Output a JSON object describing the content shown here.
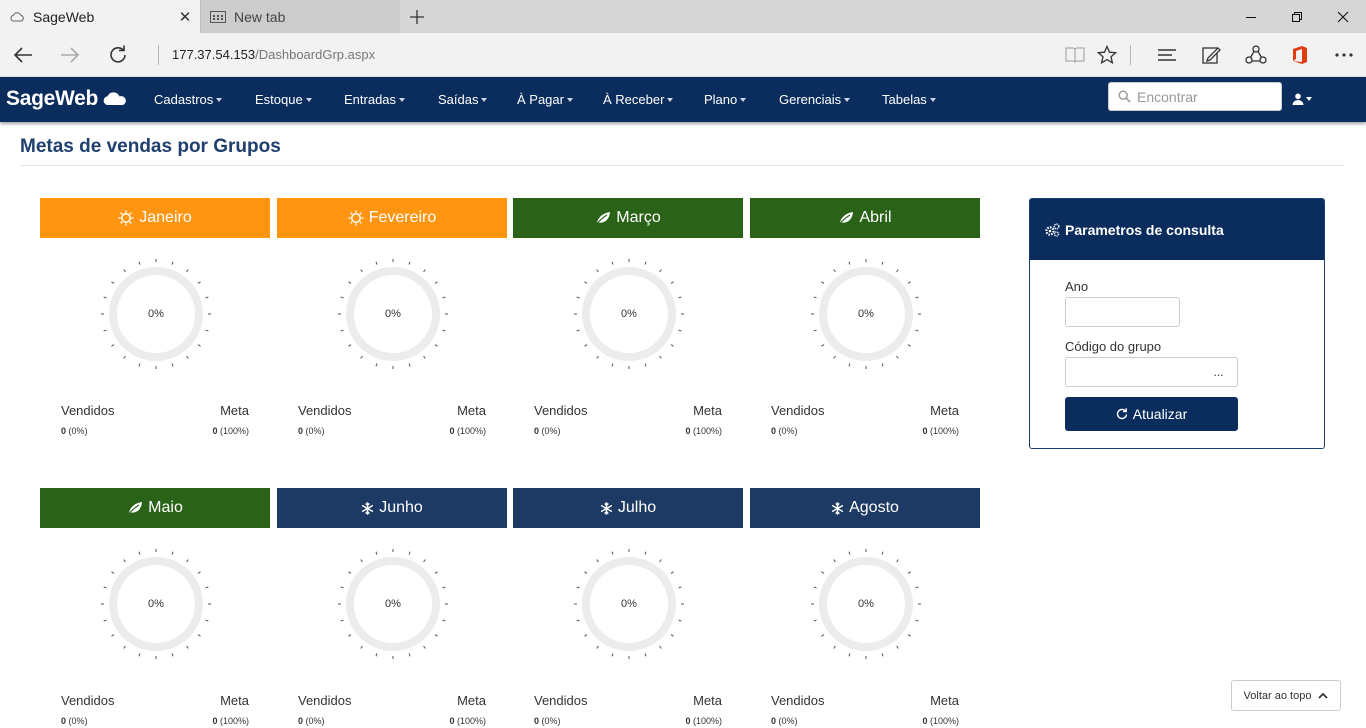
{
  "browser": {
    "tabs": [
      {
        "title": "SageWeb",
        "active": true
      },
      {
        "title": "New tab",
        "active": false
      }
    ],
    "address": {
      "host": "177.37.54.153",
      "path": "/DashboardGrp.aspx"
    }
  },
  "app": {
    "brand": "SageWeb",
    "menu": [
      "Cadastros",
      "Estoque",
      "Entradas",
      "Saídas",
      "À Pagar",
      "À Receber",
      "Plano",
      "Gerenciais",
      "Tabelas"
    ],
    "search_placeholder": "Encontrar"
  },
  "page": {
    "title": "Metas de vendas por Grupos"
  },
  "months": [
    {
      "name": "Janeiro",
      "icon": "sun-icon",
      "color": "#ff9511",
      "percent": "0%",
      "sold_label": "Vendidos",
      "goal_label": "Meta",
      "sold_value": "0",
      "sold_pct": "(0%)",
      "goal_value": "0",
      "goal_pct": "(100%)"
    },
    {
      "name": "Fevereiro",
      "icon": "sun-icon",
      "color": "#ff9511",
      "percent": "0%",
      "sold_label": "Vendidos",
      "goal_label": "Meta",
      "sold_value": "0",
      "sold_pct": "(0%)",
      "goal_value": "0",
      "goal_pct": "(100%)"
    },
    {
      "name": "Março",
      "icon": "leaf-icon",
      "color": "#2a6218",
      "percent": "0%",
      "sold_label": "Vendidos",
      "goal_label": "Meta",
      "sold_value": "0",
      "sold_pct": "(0%)",
      "goal_value": "0",
      "goal_pct": "(100%)"
    },
    {
      "name": "Abril",
      "icon": "leaf-icon",
      "color": "#2a6218",
      "percent": "0%",
      "sold_label": "Vendidos",
      "goal_label": "Meta",
      "sold_value": "0",
      "sold_pct": "(0%)",
      "goal_value": "0",
      "goal_pct": "(100%)"
    },
    {
      "name": "Maio",
      "icon": "leaf-icon",
      "color": "#2a6218",
      "percent": "0%",
      "sold_label": "Vendidos",
      "goal_label": "Meta",
      "sold_value": "0",
      "sold_pct": "(0%)",
      "goal_value": "0",
      "goal_pct": "(100%)"
    },
    {
      "name": "Junho",
      "icon": "snowflake-icon",
      "color": "#1c3a63",
      "percent": "0%",
      "sold_label": "Vendidos",
      "goal_label": "Meta",
      "sold_value": "0",
      "sold_pct": "(0%)",
      "goal_value": "0",
      "goal_pct": "(100%)"
    },
    {
      "name": "Julho",
      "icon": "snowflake-icon",
      "color": "#1c3a63",
      "percent": "0%",
      "sold_label": "Vendidos",
      "goal_label": "Meta",
      "sold_value": "0",
      "sold_pct": "(0%)",
      "goal_value": "0",
      "goal_pct": "(100%)"
    },
    {
      "name": "Agosto",
      "icon": "snowflake-icon",
      "color": "#1c3a63",
      "percent": "0%",
      "sold_label": "Vendidos",
      "goal_label": "Meta",
      "sold_value": "0",
      "sold_pct": "(0%)",
      "goal_value": "0",
      "goal_pct": "(100%)"
    }
  ],
  "params": {
    "title": "Parametros de consulta",
    "year_label": "Ano",
    "year_value": "",
    "group_label": "Código do grupo",
    "group_value": "",
    "lookup_label": "...",
    "update_label": "Atualizar"
  },
  "back_to_top": "Voltar ao topo"
}
